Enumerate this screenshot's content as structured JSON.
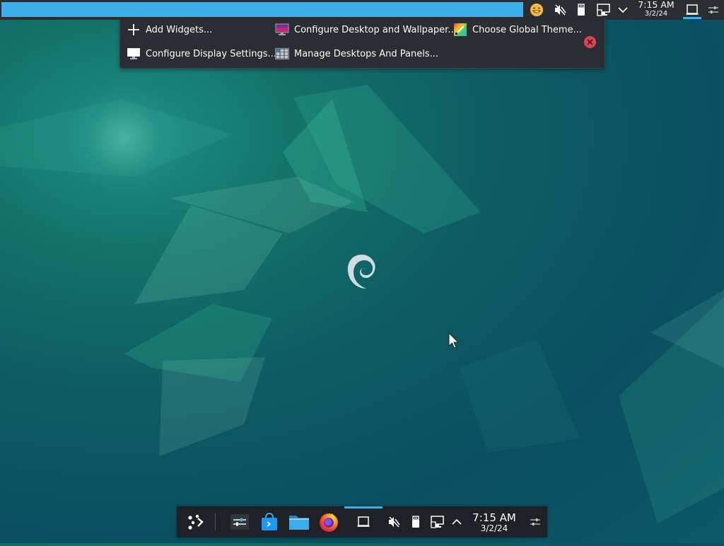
{
  "desktop": {
    "wallpaper": "debian-emerald-wallpaper",
    "logo": "debian-swirl-logo"
  },
  "colors": {
    "accent": "#3daee9",
    "panel_bg": "#2a2e32",
    "close_red": "#da4453",
    "wallpaper_base": "#0d5c63"
  },
  "top_panel": {
    "tray_icons": [
      "emoji-icon",
      "volume-muted-icon",
      "usb-device-icon",
      "network-icon",
      "chevron-down-icon"
    ],
    "clock": {
      "time": "7:15 AM",
      "date": "3/2/24"
    },
    "right_buttons": [
      "show-desktop-icon",
      "panel-settings-icon"
    ]
  },
  "toolbox": {
    "add_widgets": "Add Widgets...",
    "configure_desktop": "Configure Desktop and Wallpaper...",
    "choose_theme": "Choose Global Theme...",
    "configure_display": "Configure Display Settings...",
    "manage_desktops": "Manage Desktops And Panels...",
    "close_icon": "close-icon"
  },
  "bottom_panel": {
    "launchers": [
      "app-launcher-icon",
      "system-settings-icon",
      "discover-store-icon",
      "dolphin-files-icon",
      "firefox-icon"
    ],
    "tray_icons": [
      "show-desktop-icon",
      "volume-muted-icon",
      "usb-device-icon",
      "network-icon",
      "chevron-up-icon"
    ],
    "clock": {
      "time": "7:15 AM",
      "date": "3/2/24"
    },
    "panel_settings": "panel-settings-icon"
  }
}
